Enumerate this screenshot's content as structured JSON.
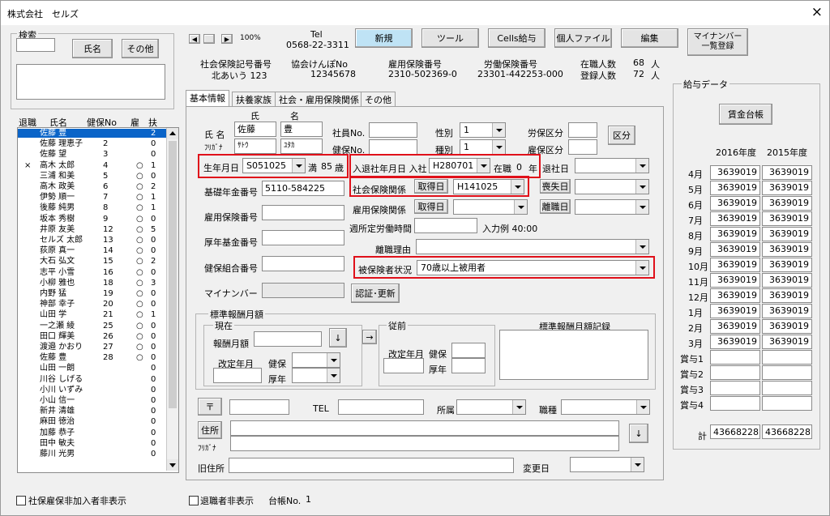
{
  "window": {
    "title": "株式会社　セルズ",
    "close": "×"
  },
  "search": {
    "group_label": "検索",
    "name_button": "氏名",
    "other_button": "その他"
  },
  "list": {
    "headers": [
      "退職",
      "氏名",
      "健保No",
      "雇",
      "扶"
    ],
    "rows": [
      {
        "ret": "",
        "name": "佐藤 豊",
        "no": "",
        "emp": "",
        "dep": "2",
        "sel": true
      },
      {
        "ret": "",
        "name": "佐藤 理恵子",
        "no": "2",
        "emp": "",
        "dep": "0"
      },
      {
        "ret": "",
        "name": "佐藤 望",
        "no": "3",
        "emp": "",
        "dep": "0"
      },
      {
        "ret": "×",
        "name": "高木 太郎",
        "no": "4",
        "emp": "○",
        "dep": "1"
      },
      {
        "ret": "",
        "name": "三浦 和美",
        "no": "5",
        "emp": "○",
        "dep": "0"
      },
      {
        "ret": "",
        "name": "高木 政美",
        "no": "6",
        "emp": "○",
        "dep": "2"
      },
      {
        "ret": "",
        "name": "伊勢 順一",
        "no": "7",
        "emp": "○",
        "dep": "1"
      },
      {
        "ret": "",
        "name": "後藤 純男",
        "no": "8",
        "emp": "○",
        "dep": "1"
      },
      {
        "ret": "",
        "name": "坂本 秀樹",
        "no": "9",
        "emp": "○",
        "dep": "0"
      },
      {
        "ret": "",
        "name": "井原 友美",
        "no": "12",
        "emp": "○",
        "dep": "5"
      },
      {
        "ret": "",
        "name": "セルズ 太郎",
        "no": "13",
        "emp": "○",
        "dep": "0"
      },
      {
        "ret": "",
        "name": "荻原 真一",
        "no": "14",
        "emp": "○",
        "dep": "0"
      },
      {
        "ret": "",
        "name": "大石 弘文",
        "no": "15",
        "emp": "○",
        "dep": "2"
      },
      {
        "ret": "",
        "name": "志平 小雪",
        "no": "16",
        "emp": "○",
        "dep": "0"
      },
      {
        "ret": "",
        "name": "小柳 雅也",
        "no": "18",
        "emp": "○",
        "dep": "3"
      },
      {
        "ret": "",
        "name": "内野 猛",
        "no": "19",
        "emp": "○",
        "dep": "0"
      },
      {
        "ret": "",
        "name": "神部 幸子",
        "no": "20",
        "emp": "○",
        "dep": "0"
      },
      {
        "ret": "",
        "name": "山田 学",
        "no": "21",
        "emp": "○",
        "dep": "1"
      },
      {
        "ret": "",
        "name": "一之瀬 綾",
        "no": "25",
        "emp": "○",
        "dep": "0"
      },
      {
        "ret": "",
        "name": "田口 輝美",
        "no": "26",
        "emp": "○",
        "dep": "0"
      },
      {
        "ret": "",
        "name": "渡邉 かおり",
        "no": "27",
        "emp": "○",
        "dep": "0"
      },
      {
        "ret": "",
        "name": "佐藤 豊",
        "no": "28",
        "emp": "○",
        "dep": "0"
      },
      {
        "ret": "",
        "name": "山田 一朗",
        "no": "",
        "emp": "",
        "dep": "0"
      },
      {
        "ret": "",
        "name": "川谷 しげる",
        "no": "",
        "emp": "",
        "dep": "0"
      },
      {
        "ret": "",
        "name": "小川 いずみ",
        "no": "",
        "emp": "",
        "dep": "0"
      },
      {
        "ret": "",
        "name": "小山 信一",
        "no": "",
        "emp": "",
        "dep": "0"
      },
      {
        "ret": "",
        "name": "新井 清雄",
        "no": "",
        "emp": "",
        "dep": "0"
      },
      {
        "ret": "",
        "name": "麻田 徳治",
        "no": "",
        "emp": "",
        "dep": "0"
      },
      {
        "ret": "",
        "name": "加藤 恭子",
        "no": "",
        "emp": "",
        "dep": "0"
      },
      {
        "ret": "",
        "name": "田中 敏夫",
        "no": "",
        "emp": "",
        "dep": "0"
      },
      {
        "ret": "",
        "name": "藤川 光男",
        "no": "",
        "emp": "",
        "dep": "0"
      }
    ]
  },
  "footer": {
    "hide_uninsured": "社保雇保非加入者非表示",
    "hide_retired": "退職者非表示",
    "ledger_no_label": "台帳No.",
    "ledger_no": "1"
  },
  "toolbar": {
    "zoom": "100%",
    "tel_label": "Tel",
    "tel": "0568-22-3311",
    "new": "新規",
    "tools": "ツール",
    "cells_pay": "Cells給与",
    "personal_file": "個人ファイル",
    "edit": "編集",
    "mynumber_list": "マイナンバー 一覧登録"
  },
  "company": {
    "social_label": "社会保険記号番号",
    "social_value": "北あいう 123",
    "kyokai_label": "協会けんぽNo",
    "kyokai_value": "12345678",
    "koyou_label": "雇用保険番号",
    "koyou_value": "2310-502369-0",
    "roudou_label": "労働保険番号",
    "roudou_value": "23301-442253-000",
    "enrolled_label": "在職人数",
    "enrolled_value": "68",
    "enrolled_unit": "人",
    "registered_label": "登録人数",
    "registered_value": "72",
    "registered_unit": "人"
  },
  "tabs": [
    "基本情報",
    "扶養家族",
    "社会・雇用保険関係",
    "その他"
  ],
  "basic": {
    "name_label": "氏 名",
    "sei_label": "氏",
    "mei_label": "名",
    "sei": "佐藤",
    "mei": "豊",
    "kana_label": "ﾌﾘｶﾞﾅ",
    "sei_kana": "ｻﾄｳ",
    "mei_kana": "ﾕﾀｶ",
    "empno_label": "社員No.",
    "kenpo_label": "健保No.",
    "sex_label": "性別",
    "sex": "1",
    "kind_label": "種別",
    "kind": "1",
    "rouho_label": "労保区分",
    "koho_label": "雇保区分",
    "kubun_button": "区分",
    "birth_label": "生年月日",
    "birth": "S051025",
    "age_prefix": "満",
    "age": "85",
    "age_unit": "歳",
    "join_label": "入退社年月日 入社",
    "join": "H280701",
    "tenure_label": "在職",
    "tenure": "0",
    "tenure_unit": "年",
    "leave_label": "退社日",
    "pension_label": "基礎年金番号",
    "pension": "5110-584225",
    "social_rel_label": "社会保険関係",
    "acquire_button": "取得日",
    "acquire": "H141025",
    "lose_button": "喪失日",
    "koyou_no_label": "雇用保険番号",
    "koyou_rel_label": "雇用保険関係",
    "koyou_acquire_button": "取得日",
    "koyou_leave_button": "離職日",
    "weekly_label": "週所定労働時間",
    "input_example": "入力例  40:00",
    "kousei_label": "厚年基金番号",
    "separation_label": "離職理由",
    "kenpo_kumiai_label": "健保組合番号",
    "insured_status_label": "被保険者状況",
    "insured_status": "70歳以上被用者",
    "mynumber_label": "マイナンバー",
    "cert_button": "認証･更新"
  },
  "salary_std": {
    "group": "標準報酬月額",
    "current": "現在",
    "monthly_label": "報酬月額",
    "revise_label": "改定年月",
    "kenpo": "健保",
    "kounen": "厚年",
    "down_arrow": "↓",
    "right_arrow": "→",
    "previous": "従前",
    "prev_revise": "改定年月",
    "prev_kenpo": "健保",
    "prev_kounen": "厚年",
    "record_label": "標準報酬月額記録"
  },
  "address": {
    "postal_button": "〒",
    "tel_label": "TEL",
    "dept_label": "所属",
    "job_label": "職種",
    "address_button": "住所",
    "kana_label": "ﾌﾘｶﾞﾅ",
    "old_label": "旧住所",
    "change_label": "変更日",
    "down": "↓"
  },
  "pay": {
    "group": "給与データ",
    "ledger_button": "賃金台帳",
    "year1": "2016年度",
    "year2": "2015年度",
    "months": [
      {
        "m": "4月",
        "a": "3639019",
        "b": "3639019"
      },
      {
        "m": "5月",
        "a": "3639019",
        "b": "3639019"
      },
      {
        "m": "6月",
        "a": "3639019",
        "b": "3639019"
      },
      {
        "m": "7月",
        "a": "3639019",
        "b": "3639019"
      },
      {
        "m": "8月",
        "a": "3639019",
        "b": "3639019"
      },
      {
        "m": "9月",
        "a": "3639019",
        "b": "3639019"
      },
      {
        "m": "10月",
        "a": "3639019",
        "b": "3639019"
      },
      {
        "m": "11月",
        "a": "3639019",
        "b": "3639019"
      },
      {
        "m": "12月",
        "a": "3639019",
        "b": "3639019"
      },
      {
        "m": "1月",
        "a": "3639019",
        "b": "3639019"
      },
      {
        "m": "2月",
        "a": "3639019",
        "b": "3639019"
      },
      {
        "m": "3月",
        "a": "3639019",
        "b": "3639019"
      },
      {
        "m": "賞与1",
        "a": "",
        "b": ""
      },
      {
        "m": "賞与2",
        "a": "",
        "b": ""
      },
      {
        "m": "賞与3",
        "a": "",
        "b": ""
      },
      {
        "m": "賞与4",
        "a": "",
        "b": ""
      }
    ],
    "total_label": "計",
    "total_a": "43668228",
    "total_b": "43668228"
  }
}
